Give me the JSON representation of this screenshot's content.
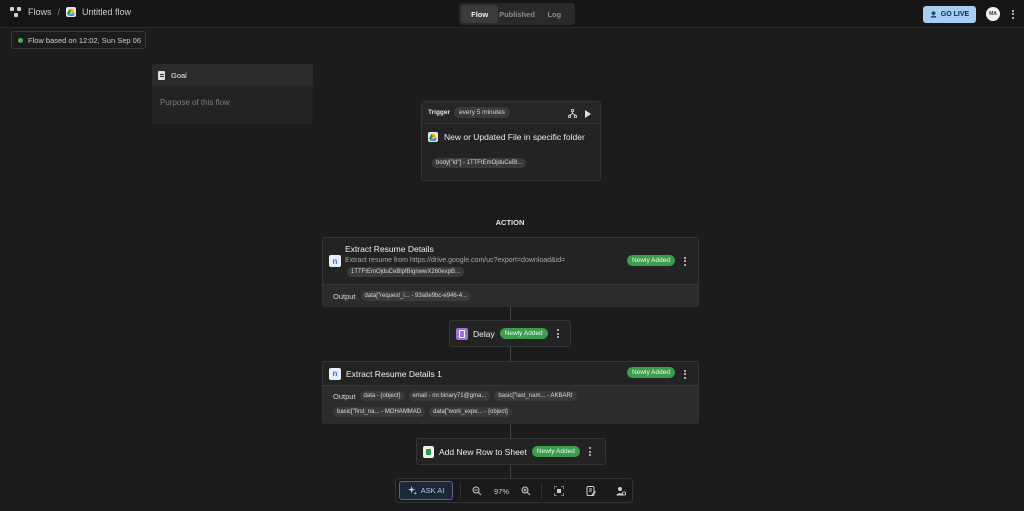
{
  "header": {
    "breadcrumb_root": "Flows",
    "breadcrumb_sep": "/",
    "flow_title": "Untitled flow",
    "tabs": [
      {
        "label": "Flow",
        "active": true
      },
      {
        "label": "Published",
        "active": false
      },
      {
        "label": "Log",
        "active": false
      }
    ],
    "go_live_label": "GO LIVE",
    "avatar_initials": "MA"
  },
  "status": {
    "flow_based_on": "Flow based on 12:02, Sun Sep 06",
    "dot_color": "#4caf50"
  },
  "goal": {
    "title": "Goal",
    "placeholder": "Purpose of this flow"
  },
  "trigger": {
    "label": "Trigger",
    "schedule": "every 5 minutes",
    "title": "New or Updated File in specific folder",
    "param": "body[\"id\"] - 1TTFtEmOjduCeBl..."
  },
  "action_heading": "ACTION",
  "steps": {
    "extract1": {
      "title": "Extract Resume Details",
      "description": "Extract resume from https://drive.google.com/uc?export=download&id=",
      "desc_pill": "1TTFtEmOjduCeBlpfBignwwX260expB...",
      "badge": "Newly Added",
      "output_label": "Output",
      "outputs": [
        "data[\"request_i... - 93a8e9bc-e946-4..."
      ]
    },
    "delay": {
      "title": "Delay",
      "badge": "Newly Added"
    },
    "extract2": {
      "title": "Extract Resume Details 1",
      "badge": "Newly Added",
      "output_label": "Output",
      "outputs": [
        "data - {object}",
        "email - mr.binary71@gma...",
        "basic[\"last_nam... - AKBARI",
        "basic[\"first_na... - MOHAMMAD",
        "data[\"work_expe... - {object}"
      ]
    },
    "addrow": {
      "title": "Add New Row to Sheet",
      "badge": "Newly Added"
    }
  },
  "toolbar": {
    "ask_ai": "ASK AI",
    "zoom": "97%",
    "icons": [
      "zoom-out-icon",
      "zoom-in-icon",
      "fit-view-icon",
      "notes-icon",
      "user-settings-icon"
    ]
  },
  "colors": {
    "background": "#1c1c1c",
    "accent_blue": "#a8ccf4",
    "badge_green": "#3d9b4d"
  }
}
